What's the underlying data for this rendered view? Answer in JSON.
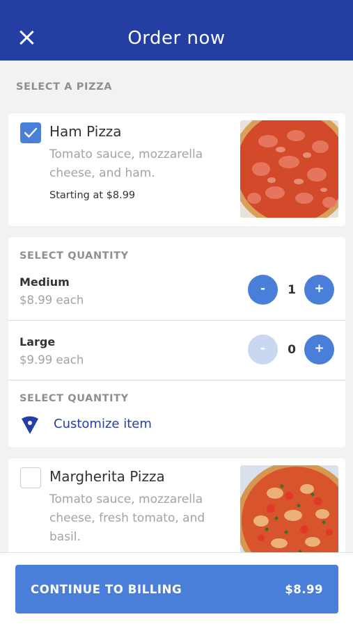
{
  "header": {
    "title": "Order now",
    "close_icon": "close-icon",
    "background": "#243fa3"
  },
  "select_pizza_heading": "SELECT A PIZZA",
  "pizzas": [
    {
      "name": "Ham Pizza",
      "description": "Tomato sauce, mozzarella cheese, and ham.",
      "price": "Starting at $8.99",
      "selected": true
    },
    {
      "name": "Margherita Pizza",
      "description": "Tomato sauce, mozzarella cheese, fresh tomato, and basil.",
      "selected": false
    }
  ],
  "quantity": {
    "heading": "SELECT QUANTITY",
    "sizes": [
      {
        "name": "Medium",
        "price": "$8.99 each",
        "count": "1",
        "minus_label": "-",
        "plus_label": "+",
        "minus_enabled": true
      },
      {
        "name": "Large",
        "price": "$9.99 each",
        "count": "0",
        "minus_label": "-",
        "plus_label": "+",
        "minus_enabled": false
      }
    ],
    "customize_heading": "SELECT QUANTITY",
    "customize_label": "Customize item",
    "customize_icon": "pizza-slice-icon"
  },
  "footer": {
    "button_label": "CONTINUE TO BILLING",
    "total": "$8.99"
  },
  "colors": {
    "accent": "#4a7fd9",
    "header": "#243fa3",
    "link": "#243fa3"
  }
}
